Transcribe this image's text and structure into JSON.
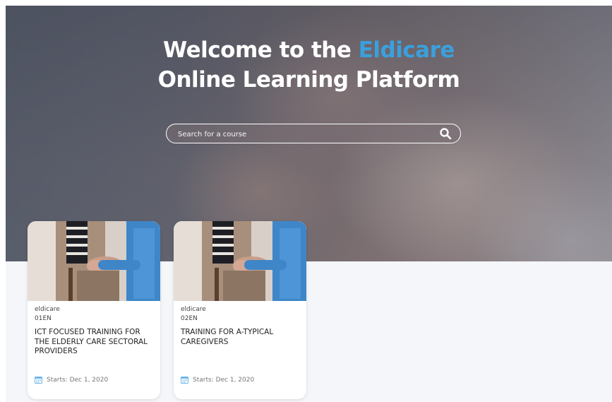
{
  "hero": {
    "title_line1_prefix": "Welcome to the ",
    "title_brand": "Eldicare",
    "title_line2": "Online Learning Platform",
    "accent_color": "#3aa0dd"
  },
  "search": {
    "placeholder": "Search for a course",
    "icon": "search-icon"
  },
  "courses": [
    {
      "org": "eldicare",
      "code": "01EN",
      "title": "ICT FOCUSED TRAINING FOR THE ELDERLY CARE SECTORAL PROVIDERS",
      "starts": "Starts: Dec 1, 2020",
      "date_icon": "calendar-icon"
    },
    {
      "org": "eldicare",
      "code": "02EN",
      "title": "TRAINING FOR A-TYPICAL CAREGIVERS",
      "starts": "Starts: Dec 1, 2020",
      "date_icon": "calendar-icon"
    }
  ]
}
